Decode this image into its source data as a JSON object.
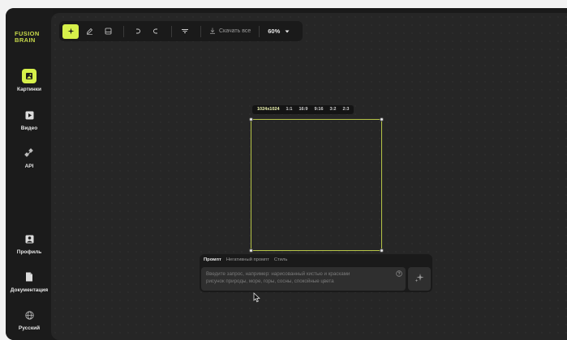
{
  "logo": {
    "line1": "FUSION",
    "line2": "BRAIN"
  },
  "sidebar": {
    "items": [
      {
        "label": "Картинки",
        "icon": "image-icon",
        "active": true
      },
      {
        "label": "Видео",
        "icon": "video-play-icon",
        "active": false
      },
      {
        "label": "API",
        "icon": "api-icon",
        "active": false
      }
    ],
    "bottom_items": [
      {
        "label": "Профиль",
        "icon": "profile-icon"
      },
      {
        "label": "Документация",
        "icon": "document-icon"
      },
      {
        "label": "Русский",
        "icon": "globe-icon"
      }
    ]
  },
  "toolbar": {
    "download_label": "Скачать все",
    "zoom": "60%"
  },
  "aspect_ratios": {
    "options": [
      "1024x1024",
      "1:1",
      "16:9",
      "9:16",
      "3:2",
      "2:3"
    ],
    "selected": "1024x1024"
  },
  "prompt": {
    "tabs": [
      "Промпт",
      "Негативный промпт",
      "Стиль"
    ],
    "active_tab": "Промпт",
    "placeholder_line1": "Введите запрос, например: нарисованный кистью и красками",
    "placeholder_line2": "рисунок природы, море, горы, сосны, спокойные цвета"
  },
  "colors": {
    "accent": "#d6f04a",
    "background": "#262626",
    "panel": "#1a1a1a"
  }
}
